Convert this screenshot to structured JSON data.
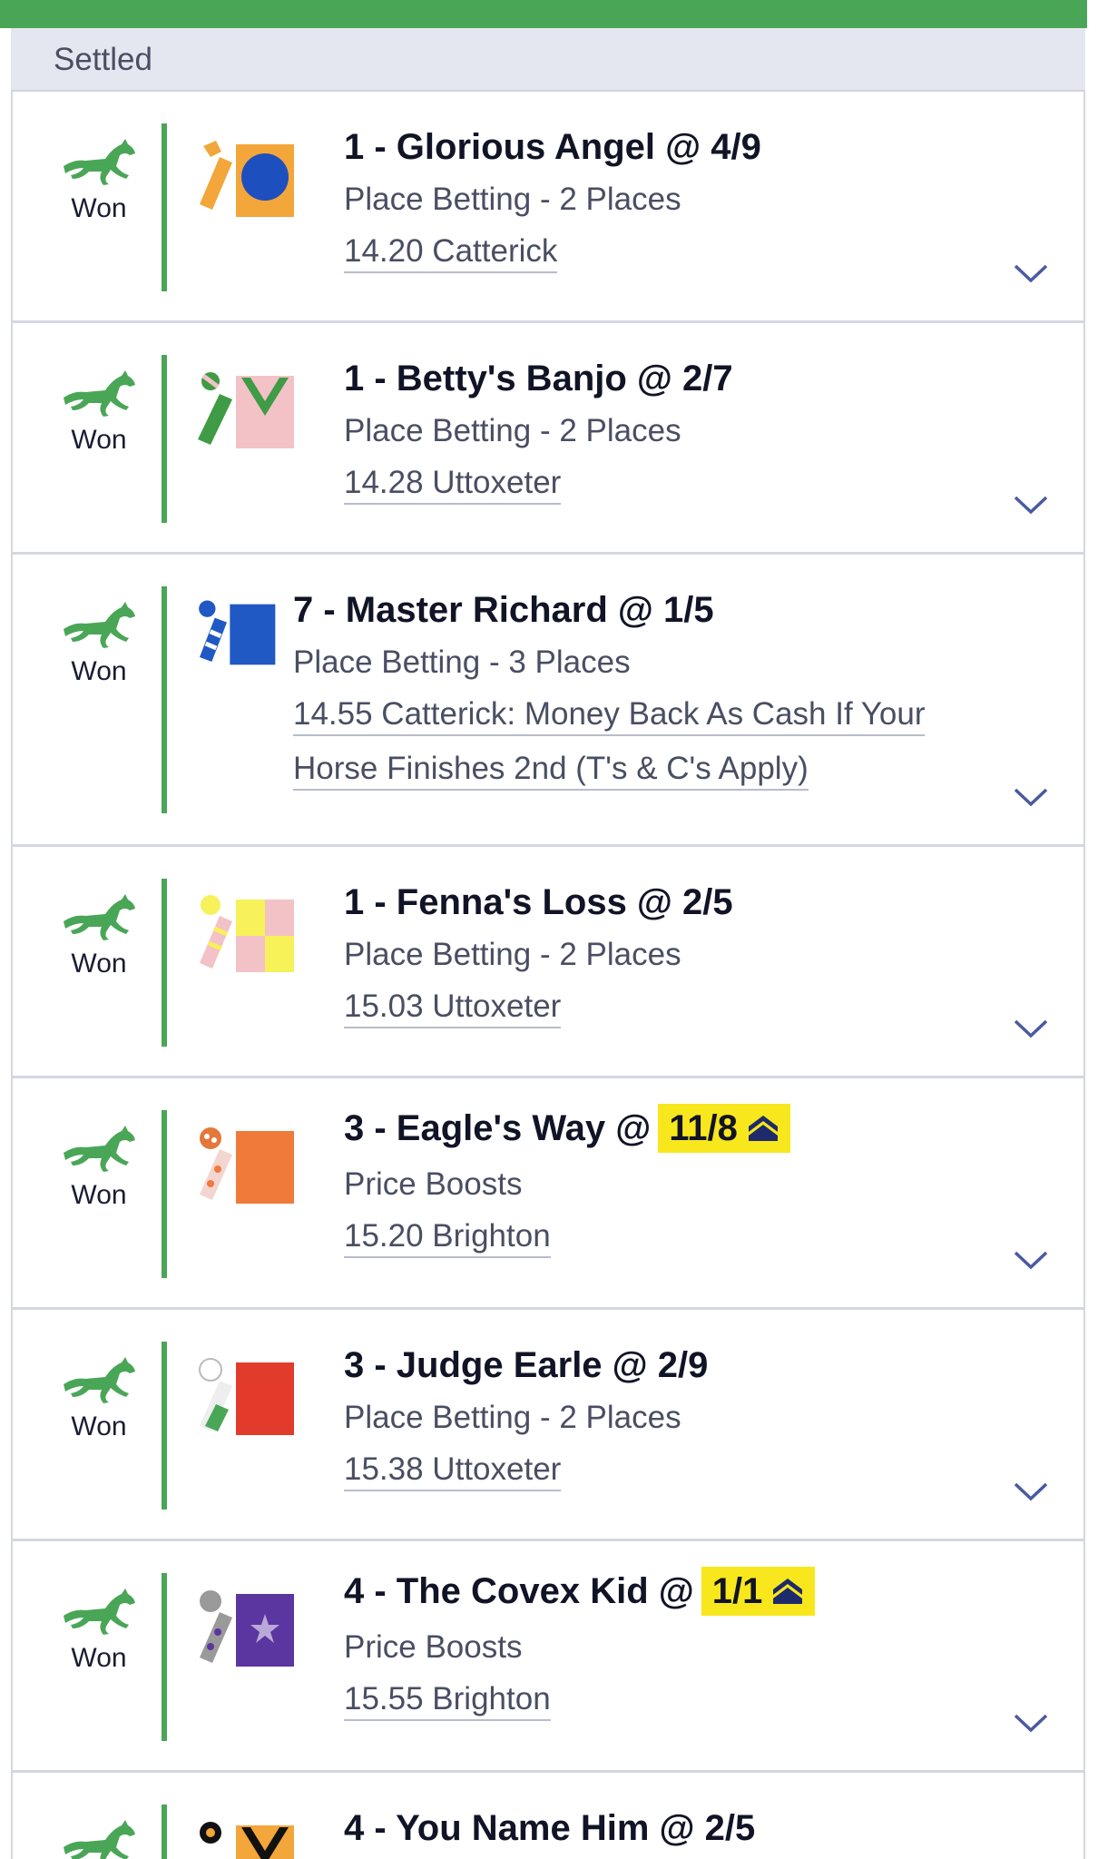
{
  "header": {
    "section_label": "Settled"
  },
  "bets": [
    {
      "status": "Won",
      "title": "1 - Glorious Angel @ 4/9",
      "market": "Place Betting - 2 Places",
      "event": "14.20 Catterick"
    },
    {
      "status": "Won",
      "title": "1 - Betty's Banjo @ 2/7",
      "market": "Place Betting - 2 Places",
      "event": "14.28 Uttoxeter"
    },
    {
      "status": "Won",
      "title": "7 - Master Richard @ 1/5",
      "market": "Place Betting - 3 Places",
      "event_line1": "14.55 Catterick: Money Back As Cash If Your",
      "event_line2": "Horse Finishes 2nd (T's & C's Apply)"
    },
    {
      "status": "Won",
      "title": "1 - Fenna's Loss @ 2/5",
      "market": "Place Betting - 2 Places",
      "event": "15.03 Uttoxeter"
    },
    {
      "status": "Won",
      "title_prefix": "3 - Eagle's Way @",
      "boosted_price": "11/8",
      "market": "Price Boosts",
      "event": "15.20 Brighton"
    },
    {
      "status": "Won",
      "title": "3 - Judge Earle @ 2/9",
      "market": "Place Betting - 2 Places",
      "event": "15.38 Uttoxeter"
    },
    {
      "status": "Won",
      "title_prefix": "4 - The Covex Kid @",
      "boosted_price": "1/1",
      "market": "Price Boosts",
      "event": "15.55 Brighton"
    },
    {
      "title": "4 - You Name Him @ 2/5"
    }
  ],
  "colors": {
    "accent_green": "#4aa657",
    "boost_yellow": "#f8e71c",
    "divider": "#d4d7e1"
  },
  "icons": {
    "status": "racehorse-icon",
    "expand": "chevron-down-icon",
    "boost": "price-boost-icon"
  }
}
